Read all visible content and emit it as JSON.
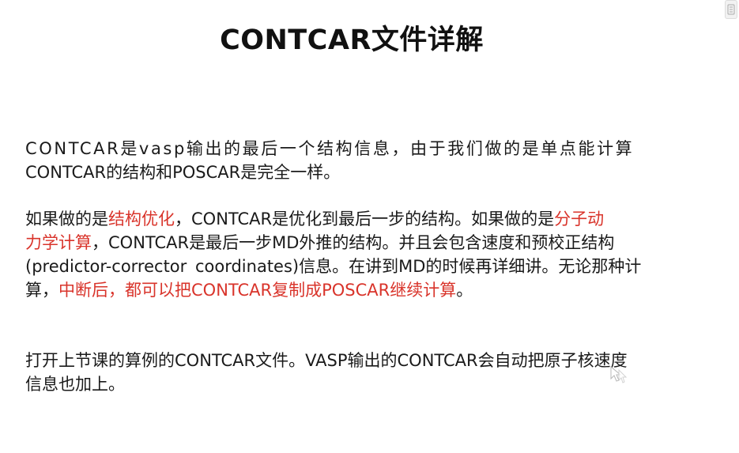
{
  "slide": {
    "title": "CONTCAR文件详解",
    "para1": {
      "line1": "CONTCAR是vasp输出的最后一个结构信息，由于我们做的是单点能计算",
      "line2": "CONTCAR的结构和POSCAR是完全一样。"
    },
    "para2": {
      "l1_a": "如果做的是",
      "l1_red1": "结构优化",
      "l1_b": "，CONTCAR是优化到最后一步的结构。如果做的是",
      "l1_red2": "分子动",
      "l2_red": "力学计算",
      "l2_b": "，CONTCAR是最后一步MD外推的结构。并且会包含速度和预校正结构",
      "l3": "(predictor-corrector  coordinates)信息。在讲到MD的时候再详细讲。无论那种计",
      "l4_a": "算，",
      "l4_red": "中断后，都可以把CONTCAR复制成POSCAR继续计算",
      "l4_b": "。"
    },
    "para3": {
      "line1": "打开上节课的算例的CONTCAR文件。VASP输出的CONTCAR会自动把原子核速度",
      "line2": "信息也加上。"
    }
  },
  "colors": {
    "highlight_red": "#d9342b",
    "text": "#1a1a1a"
  },
  "icons": {
    "corner": "side-panel-tab-icon",
    "cursor": "mouse-pointer-icon"
  }
}
